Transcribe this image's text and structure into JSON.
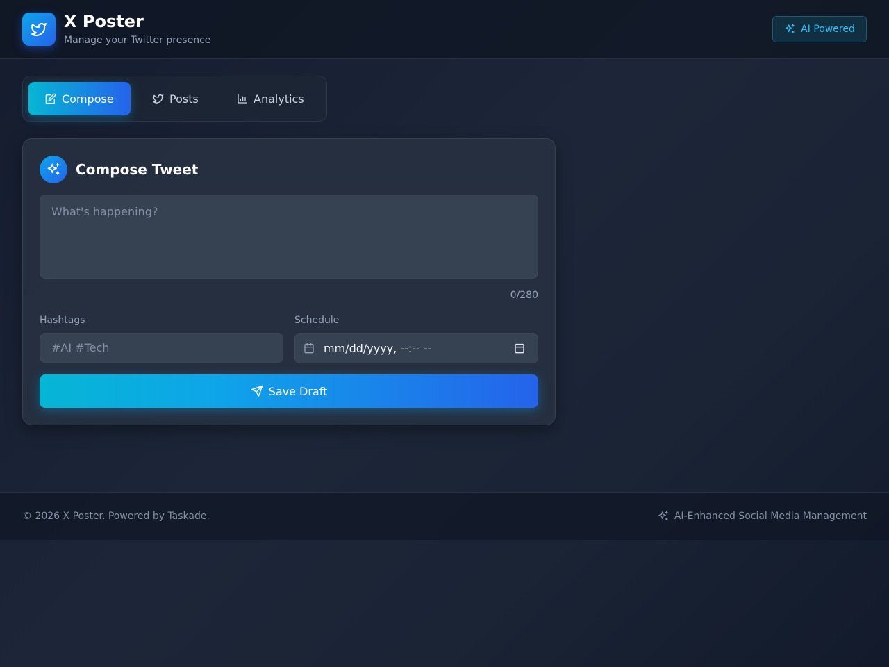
{
  "header": {
    "title": "X Poster",
    "subtitle": "Manage your Twitter presence",
    "badge_label": "AI Powered",
    "logo_icon": "twitter-bird-icon"
  },
  "tabs": [
    {
      "label": "Compose",
      "icon": "edit-icon",
      "active": true
    },
    {
      "label": "Posts",
      "icon": "twitter-bird-icon",
      "active": false
    },
    {
      "label": "Analytics",
      "icon": "bar-chart-icon",
      "active": false
    }
  ],
  "compose": {
    "title": "Compose Tweet",
    "tweet_value": "",
    "tweet_placeholder": "What's happening?",
    "char_count": "0/280",
    "hashtags_label": "Hashtags",
    "hashtags_value": "",
    "hashtags_placeholder": "#AI #Tech",
    "schedule_label": "Schedule",
    "schedule_value": "mm/dd/yyyy, --:-- --",
    "save_label": "Save Draft"
  },
  "footer": {
    "copyright": "© 2026 X Poster. Powered by Taskade.",
    "tagline": "AI-Enhanced Social Media Management"
  },
  "colors": {
    "accent_start": "#06b6d4",
    "accent_end": "#2563eb",
    "badge_text": "#38bdf8"
  }
}
